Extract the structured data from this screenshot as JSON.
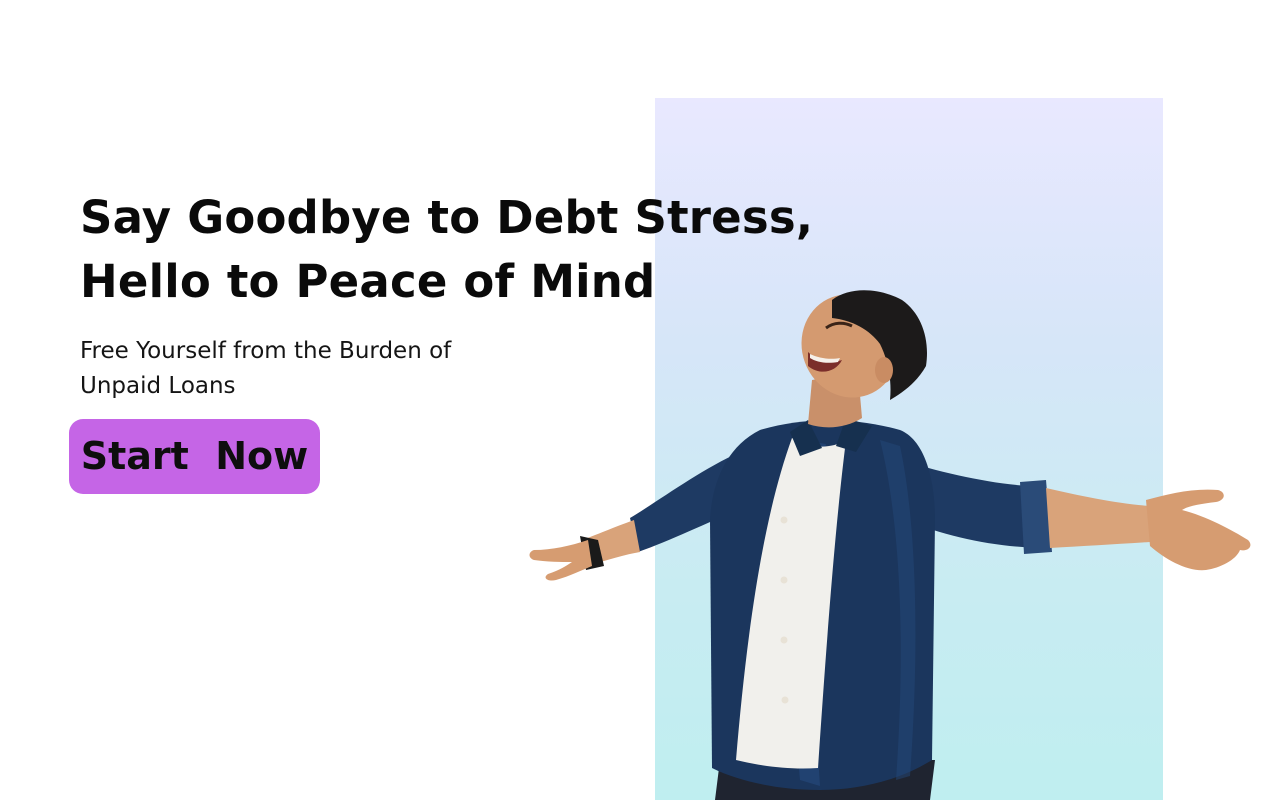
{
  "hero": {
    "headline_line1": "Say Goodbye to Debt Stress,",
    "headline_line2": "Hello to Peace of Mind",
    "subheadline_line1": "Free Yourself from the Burden of",
    "subheadline_line2": "Unpaid Loans",
    "cta_label": "Start  Now",
    "image": "man-arms-outstretched-smiling"
  },
  "colors": {
    "background": "#ffffff",
    "cta": "#c565e6",
    "panel_top": "#e9e8ff",
    "panel_bottom": "#bfeef0",
    "text": "#0a0a0a"
  }
}
